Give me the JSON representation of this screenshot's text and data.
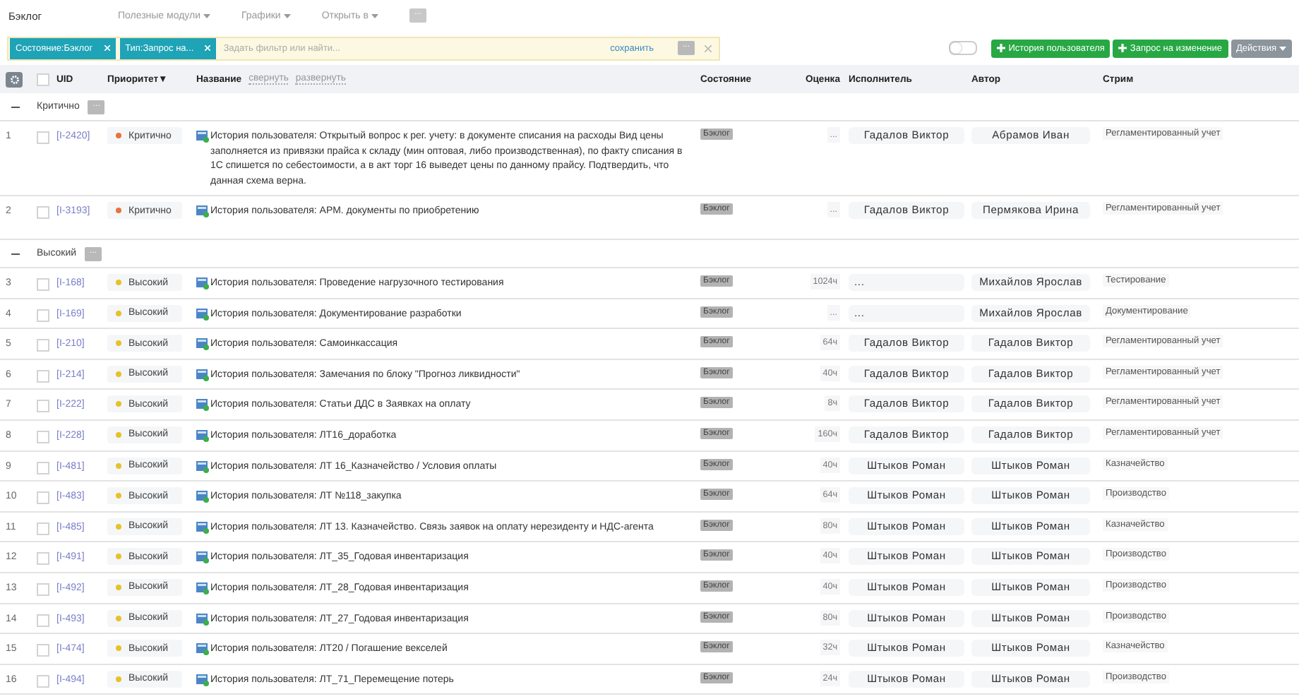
{
  "topbar": {
    "title": "Бэклог",
    "menus": [
      {
        "label": "Полезные модули"
      },
      {
        "label": "Графики"
      },
      {
        "label": "Открыть в"
      }
    ],
    "more": "..."
  },
  "filter": {
    "chips": [
      {
        "label": "Состояние:Бэклог"
      },
      {
        "label": "Тип:Запрос на..."
      }
    ],
    "placeholder": "Задать фильтр или найти...",
    "save": "сохранить",
    "more": "..."
  },
  "toggle": {
    "on": false
  },
  "actions": [
    {
      "kind": "create",
      "label": "История пользователя"
    },
    {
      "kind": "create",
      "label": "Запрос на изменение"
    },
    {
      "kind": "menu",
      "label": "Действия"
    }
  ],
  "table": {
    "header_checked": false,
    "columns": [
      {
        "kind": "uid",
        "label": "UID"
      },
      {
        "kind": "priority",
        "label": "Приоритет▼"
      },
      {
        "kind": "name",
        "label": "Название",
        "links": [
          "свернуть",
          "развернуть"
        ]
      },
      {
        "kind": "state",
        "label": "Состояние"
      },
      {
        "kind": "estimate",
        "label": "Оценка"
      },
      {
        "kind": "assignee",
        "label": "Исполнитель"
      },
      {
        "kind": "author",
        "label": "Автор"
      },
      {
        "kind": "stream",
        "label": "Стрим"
      }
    ],
    "groups": [
      {
        "label": "Критично",
        "expanded": true,
        "more": "...",
        "rows": [
          {
            "num": "1",
            "checked": false,
            "uid": "[I-2420]",
            "priority": "Критично",
            "color": "#e8743b",
            "title": "История пользователя: Открытый вопрос к рег. учету: в документе списания на расходы Вид цены заполняется из привязки прайса к складу (мин оптовая, либо производственная), по факту списания в 1С спишется по себестоимости, а в акт торг 16 выведет цены по данному прайсу. Подтвердить, что данная схема верна.",
            "state": "Бэклог",
            "estimate": "...",
            "assignee": "Гадалов Виктор",
            "author": "Абрамов Иван",
            "stream": "Регламентированный учет"
          },
          {
            "num": "2",
            "checked": false,
            "uid": "[I-3193]",
            "priority": "Критично",
            "color": "#e8743b",
            "title": "История пользователя: АРМ. документы по приобретению",
            "state": "Бэклог",
            "estimate": "...",
            "assignee": "Гадалов Виктор",
            "author": "Пермякова Ирина",
            "stream": "Регламентированный учет"
          }
        ]
      },
      {
        "label": "Высокий",
        "expanded": true,
        "more": "...",
        "rows": [
          {
            "num": "3",
            "checked": false,
            "uid": "[I-168]",
            "priority": "Высокий",
            "color": "#e6c229",
            "title": "История пользователя: Проведение нагрузочного тестирования",
            "state": "Бэклог",
            "estimate": "1024ч",
            "assignee": "...",
            "author": "Михайлов Ярослав",
            "stream": "Тестирование"
          },
          {
            "num": "4",
            "checked": false,
            "uid": "[I-169]",
            "priority": "Высокий",
            "color": "#e6c229",
            "title": "История пользователя: Документирование разработки",
            "state": "Бэклог",
            "estimate": "...",
            "assignee": "...",
            "author": "Михайлов Ярослав",
            "stream": "Документирование"
          },
          {
            "num": "5",
            "checked": false,
            "uid": "[I-210]",
            "priority": "Высокий",
            "color": "#e6c229",
            "title": "История пользователя: Самоинкассация",
            "state": "Бэклог",
            "estimate": "64ч",
            "assignee": "Гадалов Виктор",
            "author": "Гадалов Виктор",
            "stream": "Регламентированный учет"
          },
          {
            "num": "6",
            "checked": false,
            "uid": "[I-214]",
            "priority": "Высокий",
            "color": "#e6c229",
            "title": "История пользователя: Замечания по блоку \"Прогноз ликвидности\"",
            "state": "Бэклог",
            "estimate": "40ч",
            "assignee": "Гадалов Виктор",
            "author": "Гадалов Виктор",
            "stream": "Регламентированный учет"
          },
          {
            "num": "7",
            "checked": false,
            "uid": "[I-222]",
            "priority": "Высокий",
            "color": "#e6c229",
            "title": "История пользователя: Статьи ДДС в Заявках на оплату",
            "state": "Бэклог",
            "estimate": "8ч",
            "assignee": "Гадалов Виктор",
            "author": "Гадалов Виктор",
            "stream": "Регламентированный учет"
          },
          {
            "num": "8",
            "checked": false,
            "uid": "[I-228]",
            "priority": "Высокий",
            "color": "#e6c229",
            "title": "История пользователя: ЛТ16_доработка",
            "state": "Бэклог",
            "estimate": "160ч",
            "assignee": "Гадалов Виктор",
            "author": "Гадалов Виктор",
            "stream": "Регламентированный учет"
          },
          {
            "num": "9",
            "checked": false,
            "uid": "[I-481]",
            "priority": "Высокий",
            "color": "#e6c229",
            "title": "История пользователя: ЛТ 16_Казначейство / Условия оплаты",
            "state": "Бэклог",
            "estimate": "40ч",
            "assignee": "Штыков Роман",
            "author": "Штыков Роман",
            "stream": "Казначейство"
          },
          {
            "num": "10",
            "checked": false,
            "uid": "[I-483]",
            "priority": "Высокий",
            "color": "#e6c229",
            "title": "История пользователя: ЛТ №118_закупка",
            "state": "Бэклог",
            "estimate": "64ч",
            "assignee": "Штыков Роман",
            "author": "Штыков Роман",
            "stream": "Производство"
          },
          {
            "num": "11",
            "checked": false,
            "uid": "[I-485]",
            "priority": "Высокий",
            "color": "#e6c229",
            "title": "История пользователя: ЛТ 13. Казначейство. Связь заявок на оплату нерезиденту и НДС-агента",
            "state": "Бэклог",
            "estimate": "80ч",
            "assignee": "Штыков Роман",
            "author": "Штыков Роман",
            "stream": "Казначейство"
          },
          {
            "num": "12",
            "checked": false,
            "uid": "[I-491]",
            "priority": "Высокий",
            "color": "#e6c229",
            "title": "История пользователя: ЛТ_35_Годовая инвентаризация",
            "state": "Бэклог",
            "estimate": "40ч",
            "assignee": "Штыков Роман",
            "author": "Штыков Роман",
            "stream": "Производство"
          },
          {
            "num": "13",
            "checked": false,
            "uid": "[I-492]",
            "priority": "Высокий",
            "color": "#e6c229",
            "title": "История пользователя: ЛТ_28_Годовая инвентаризация",
            "state": "Бэклог",
            "estimate": "40ч",
            "assignee": "Штыков Роман",
            "author": "Штыков Роман",
            "stream": "Производство"
          },
          {
            "num": "14",
            "checked": false,
            "uid": "[I-493]",
            "priority": "Высокий",
            "color": "#e6c229",
            "title": "История пользователя: ЛТ_27_Годовая инвентаризация",
            "state": "Бэклог",
            "estimate": "80ч",
            "assignee": "Штыков Роман",
            "author": "Штыков Роман",
            "stream": "Производство"
          },
          {
            "num": "15",
            "checked": false,
            "uid": "[I-474]",
            "priority": "Высокий",
            "color": "#e6c229",
            "title": "История пользователя: ЛТ20 / Погашение векселей",
            "state": "Бэклог",
            "estimate": "32ч",
            "assignee": "Штыков Роман",
            "author": "Штыков Роман",
            "stream": "Казначейство"
          },
          {
            "num": "16",
            "checked": false,
            "uid": "[I-494]",
            "priority": "Высокий",
            "color": "#e6c229",
            "title": "История пользователя: ЛТ_71_Перемещение потерь",
            "state": "Бэклог",
            "estimate": "24ч",
            "assignee": "Штыков Роман",
            "author": "Штыков Роман",
            "stream": "Производство"
          }
        ]
      }
    ]
  }
}
